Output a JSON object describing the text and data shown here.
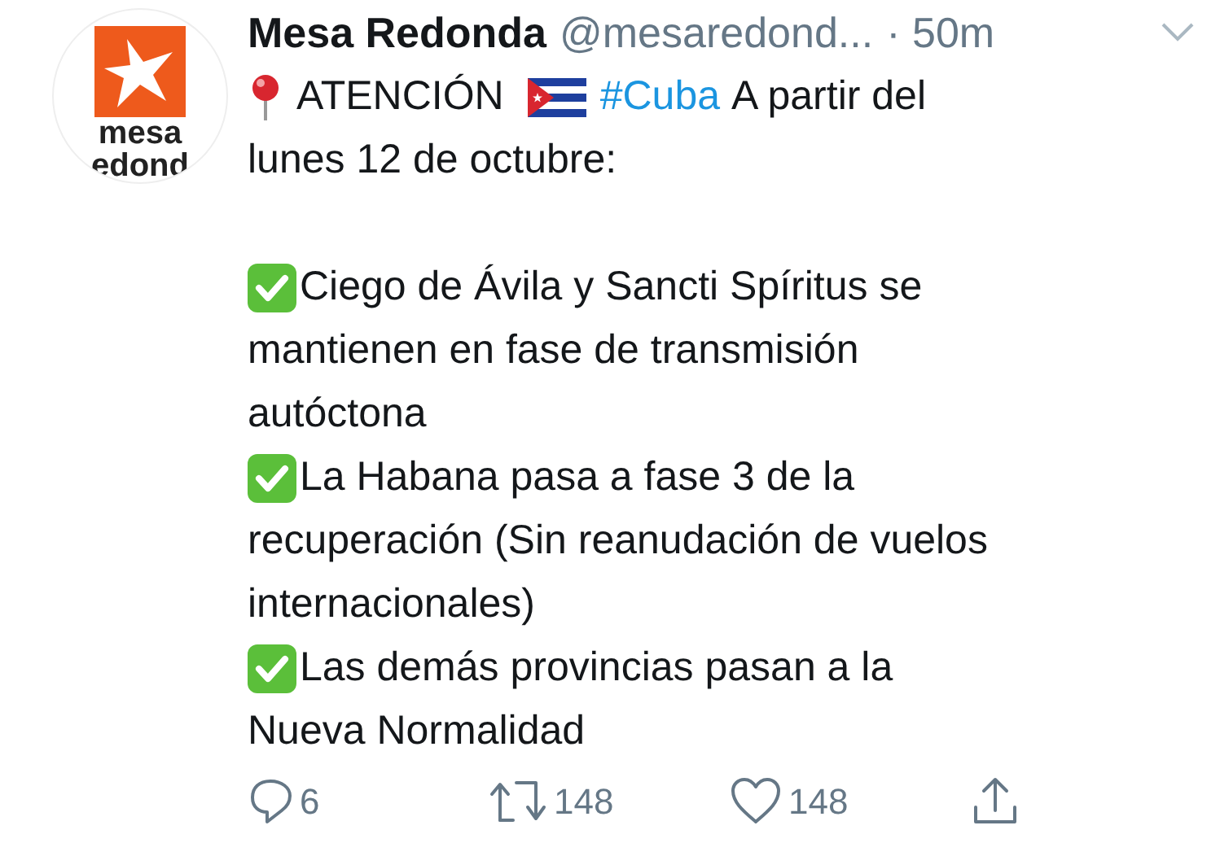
{
  "avatar": {
    "logo_lines": [
      "mesa",
      "edond"
    ]
  },
  "header": {
    "name": "Mesa Redonda",
    "handle": "@mesaredond...",
    "time": "· 50m"
  },
  "intro_lines": [
    [
      {
        "kind": "pin"
      },
      {
        "kind": "text",
        "text": "ATENCIÓN"
      },
      {
        "kind": "flag"
      },
      {
        "kind": "hashtag",
        "text": "#Cuba"
      },
      {
        "kind": "text",
        "text": "A partir del"
      }
    ],
    [
      {
        "kind": "text",
        "text": "lunes 12 de octubre:"
      }
    ]
  ],
  "items": [
    {
      "lines": [
        "Ciego de Ávila y Sancti Spíritus se",
        "mantienen en fase de transmisión",
        "autóctona"
      ]
    },
    {
      "lines": [
        "La Habana pasa a fase 3 de la",
        "recuperación (Sin reanudación de vuelos",
        "internacionales)"
      ]
    },
    {
      "lines": [
        "Las demás provincias pasan a la",
        "Nueva Normalidad"
      ]
    }
  ],
  "actions": [
    {
      "kind": "reply",
      "count": "6"
    },
    {
      "kind": "retweet",
      "count": "148"
    },
    {
      "kind": "like",
      "count": "148"
    },
    {
      "kind": "share"
    }
  ]
}
